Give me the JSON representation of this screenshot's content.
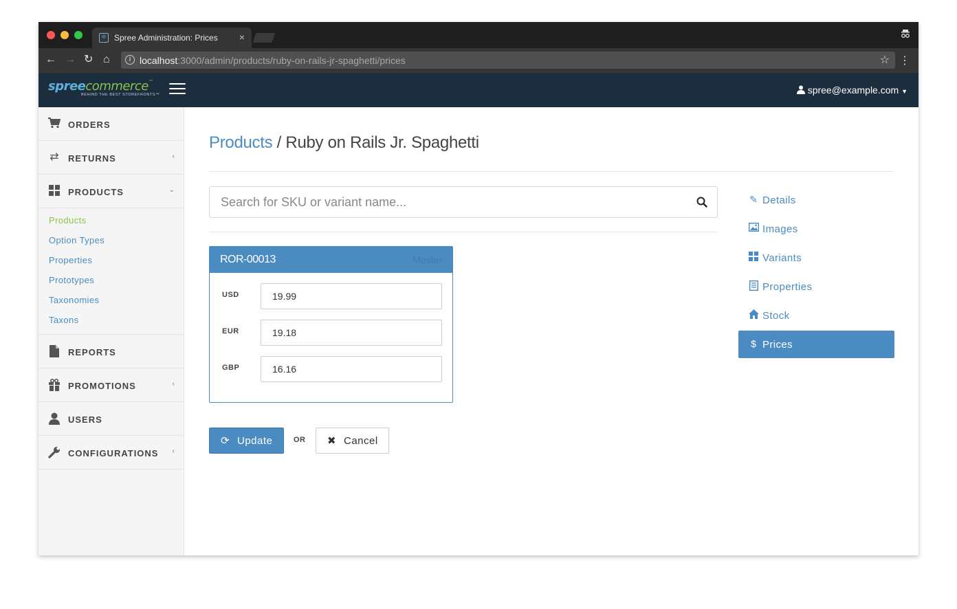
{
  "browser": {
    "tab_title": "Spree Administration: Prices",
    "tab_close": "×",
    "url_host": "localhost",
    "url_path": ":3000/admin/products/ruby-on-rails-jr-spaghetti/prices"
  },
  "header": {
    "logo_word1": "spree",
    "logo_word2": "commerce",
    "logo_tm": "™",
    "logo_tagline": "BEHIND THE BEST STOREFRONTS™",
    "user_email": "spree@example.com"
  },
  "sidebar": {
    "items": [
      {
        "label": "ORDERS",
        "icon": "cart-icon"
      },
      {
        "label": "RETURNS",
        "icon": "exchange-icon"
      },
      {
        "label": "PRODUCTS",
        "icon": "grid-icon"
      },
      {
        "label": "REPORTS",
        "icon": "file-icon"
      },
      {
        "label": "PROMOTIONS",
        "icon": "gift-icon"
      },
      {
        "label": "USERS",
        "icon": "user-icon"
      },
      {
        "label": "CONFIGURATIONS",
        "icon": "wrench-icon"
      }
    ],
    "products_sub": [
      "Products",
      "Option Types",
      "Properties",
      "Prototypes",
      "Taxonomies",
      "Taxons"
    ]
  },
  "main": {
    "breadcrumb_link": "Products",
    "breadcrumb_sep": " / ",
    "title": "Ruby on Rails Jr. Spaghetti",
    "search_placeholder": "Search for SKU or variant name...",
    "panel": {
      "sku": "ROR-00013",
      "badge": "Master",
      "prices": [
        {
          "currency": "USD",
          "value": "19.99"
        },
        {
          "currency": "EUR",
          "value": "19.18"
        },
        {
          "currency": "GBP",
          "value": "16.16"
        }
      ]
    },
    "update_label": "Update",
    "or_label": "OR",
    "cancel_label": "Cancel"
  },
  "right_nav": {
    "items": [
      {
        "label": "Details",
        "icon": "pencil-icon"
      },
      {
        "label": "Images",
        "icon": "picture-icon"
      },
      {
        "label": "Variants",
        "icon": "grid-icon"
      },
      {
        "label": "Properties",
        "icon": "list-icon"
      },
      {
        "label": "Stock",
        "icon": "home-icon"
      },
      {
        "label": "Prices",
        "icon": "dollar-icon"
      }
    ],
    "active": "Prices"
  },
  "colors": {
    "brand_blue": "#4a8cc2",
    "header_bg": "#1c2d3e",
    "active_green": "#8bc34a"
  }
}
